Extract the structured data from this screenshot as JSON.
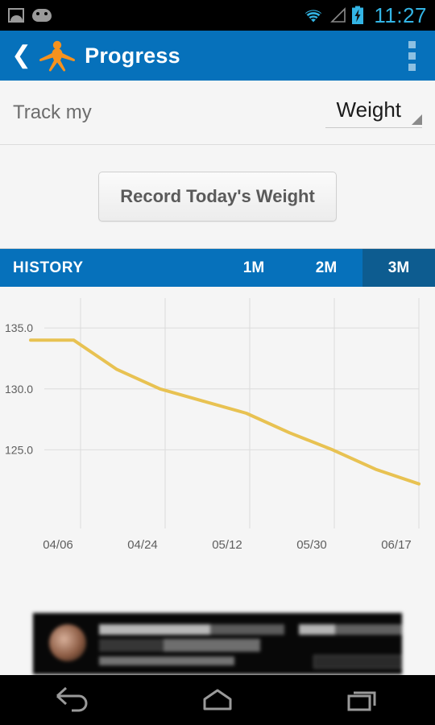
{
  "statusbar": {
    "icons": [
      "photo-icon",
      "android-head-icon",
      "wifi-icon",
      "signal-icon",
      "battery-charging-icon"
    ],
    "clock": "11:27",
    "clock_color": "#33b5e5"
  },
  "actionbar": {
    "back_icon": "back-chevron-icon",
    "logo_icon": "jumping-person-logo",
    "logo_color": "#F6921E",
    "title": "Progress",
    "overflow_icon": "overflow-menu-icon",
    "bg_color": "#0671bb"
  },
  "track": {
    "label": "Track my",
    "selected_metric": "Weight",
    "options": [
      "Weight"
    ]
  },
  "actions": {
    "record_button": "Record Today's Weight"
  },
  "history": {
    "title": "HISTORY",
    "ranges": [
      {
        "label": "1M",
        "selected": false
      },
      {
        "label": "2M",
        "selected": false
      },
      {
        "label": "3M",
        "selected": true
      }
    ],
    "selected_range": "3M",
    "selected_bg": "#0d5c90"
  },
  "chart_data": {
    "type": "line",
    "title": "",
    "xlabel": "",
    "ylabel": "",
    "line_color": "#E8C252",
    "grid": true,
    "legend": false,
    "ylim": [
      120.0,
      136.0
    ],
    "yticks": [
      135.0,
      130.0,
      125.0
    ],
    "ytick_labels": [
      "135.0",
      "130.0",
      "125.0"
    ],
    "xtick_labels": [
      "04/06",
      "04/24",
      "05/12",
      "05/30",
      "06/17"
    ],
    "series": [
      {
        "name": "Weight",
        "x": [
          "03/30",
          "04/06",
          "04/13",
          "04/24",
          "05/03",
          "05/12",
          "05/21",
          "05/30",
          "06/08",
          "06/17"
        ],
        "values": [
          134.0,
          134.0,
          131.6,
          130.0,
          129.0,
          128.0,
          126.4,
          125.0,
          123.4,
          122.2
        ]
      }
    ]
  },
  "ad": {
    "name": "ad-banner",
    "state": "blurred-advertisement"
  },
  "navbar": {
    "buttons": [
      {
        "name": "back-nav-icon",
        "label": "Back"
      },
      {
        "name": "home-nav-icon",
        "label": "Home"
      },
      {
        "name": "recents-nav-icon",
        "label": "Recents"
      }
    ]
  }
}
